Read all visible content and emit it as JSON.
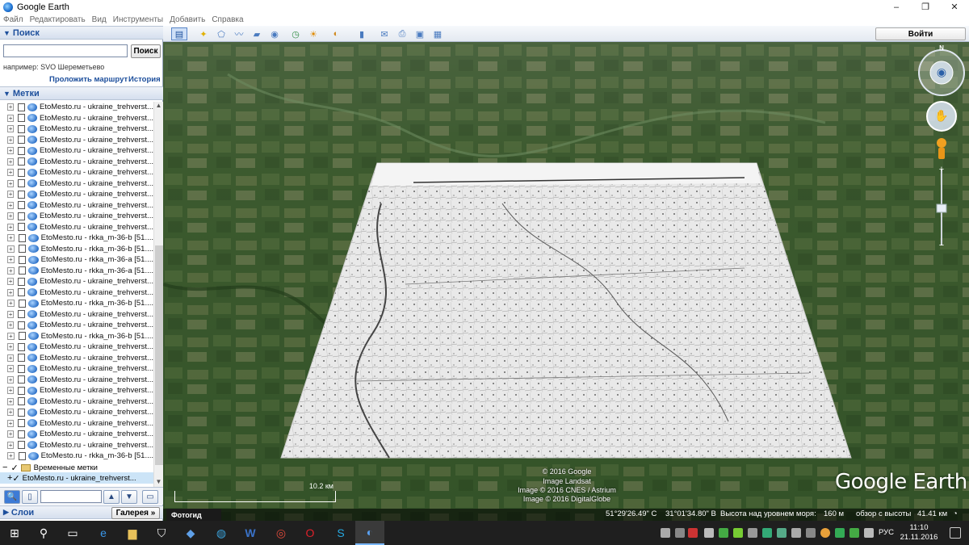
{
  "window": {
    "title": "Google Earth",
    "minimize": "–",
    "maximize": "❐",
    "close": "✕"
  },
  "menu": [
    "Файл",
    "Редактировать",
    "Вид",
    "Инструменты",
    "Добавить",
    "Справка"
  ],
  "search": {
    "header": "Поиск",
    "input_value": "",
    "button": "Поиск",
    "example": "например: SVO Шереметьево",
    "route_link": "Проложить маршрут",
    "history_link": "История"
  },
  "places": {
    "header": "Метки",
    "items": [
      "EtoMesto.ru - ukraine_trehverst...",
      "EtoMesto.ru - ukraine_trehverst...",
      "EtoMesto.ru - ukraine_trehverst...",
      "EtoMesto.ru - ukraine_trehverst...",
      "EtoMesto.ru - ukraine_trehverst...",
      "EtoMesto.ru - ukraine_trehverst...",
      "EtoMesto.ru - ukraine_trehverst...",
      "EtoMesto.ru - ukraine_trehverst...",
      "EtoMesto.ru - ukraine_trehverst...",
      "EtoMesto.ru - ukraine_trehverst...",
      "EtoMesto.ru - ukraine_trehverst...",
      "EtoMesto.ru - ukraine_trehverst...",
      "EtoMesto.ru - rkka_m-36-b [51....",
      "EtoMesto.ru - rkka_m-36-b [51....",
      "EtoMesto.ru - rkka_m-36-a [51....",
      "EtoMesto.ru - rkka_m-36-a [51....",
      "EtoMesto.ru - ukraine_trehverst...",
      "EtoMesto.ru - ukraine_trehverst...",
      "EtoMesto.ru - rkka_m-36-b [51....",
      "EtoMesto.ru - ukraine_trehverst...",
      "EtoMesto.ru - ukraine_trehverst...",
      "EtoMesto.ru - rkka_m-36-b [51....",
      "EtoMesto.ru - ukraine_trehverst...",
      "EtoMesto.ru - ukraine_trehverst...",
      "EtoMesto.ru - ukraine_trehverst...",
      "EtoMesto.ru - ukraine_trehverst...",
      "EtoMesto.ru - ukraine_trehverst...",
      "EtoMesto.ru - ukraine_trehverst...",
      "EtoMesto.ru - ukraine_trehverst...",
      "EtoMesto.ru - ukraine_trehverst...",
      "EtoMesto.ru - ukraine_trehverst...",
      "EtoMesto.ru - ukraine_trehverst...",
      "EtoMesto.ru - rkka_m-36-b [51...."
    ],
    "temp_folder": "Временные метки",
    "selected_item": "EtoMesto.ru - ukraine_trehverst..."
  },
  "layers": {
    "header": "Слои",
    "gallery": "Галерея »"
  },
  "toolbar": {
    "login": "Войти"
  },
  "map": {
    "attribution": [
      "© 2016 Google",
      "Image Landsat",
      "Image © 2016 CNES / Astrium",
      "Image © 2016 DigitalGlobe"
    ],
    "logo": "Google Earth",
    "scale_label": "10.2 км",
    "photo_tab": "Фотогид",
    "compass_n": "N",
    "status": {
      "lat": "51°29'26.49\" С",
      "lon": "31°01'34.80\" В",
      "elevation_label": "Высота над уровнем моря:",
      "elevation": "160 м",
      "eye_label": "обзор с высоты",
      "eye": "41.41 км"
    }
  },
  "taskbar": {
    "lang": "РУС",
    "time": "11:10",
    "date": "21.11.2016"
  },
  "colors": {
    "accent": "#1d4f9c",
    "map_green": "#3b5a2a",
    "taskbar": "#1f1f1f"
  }
}
